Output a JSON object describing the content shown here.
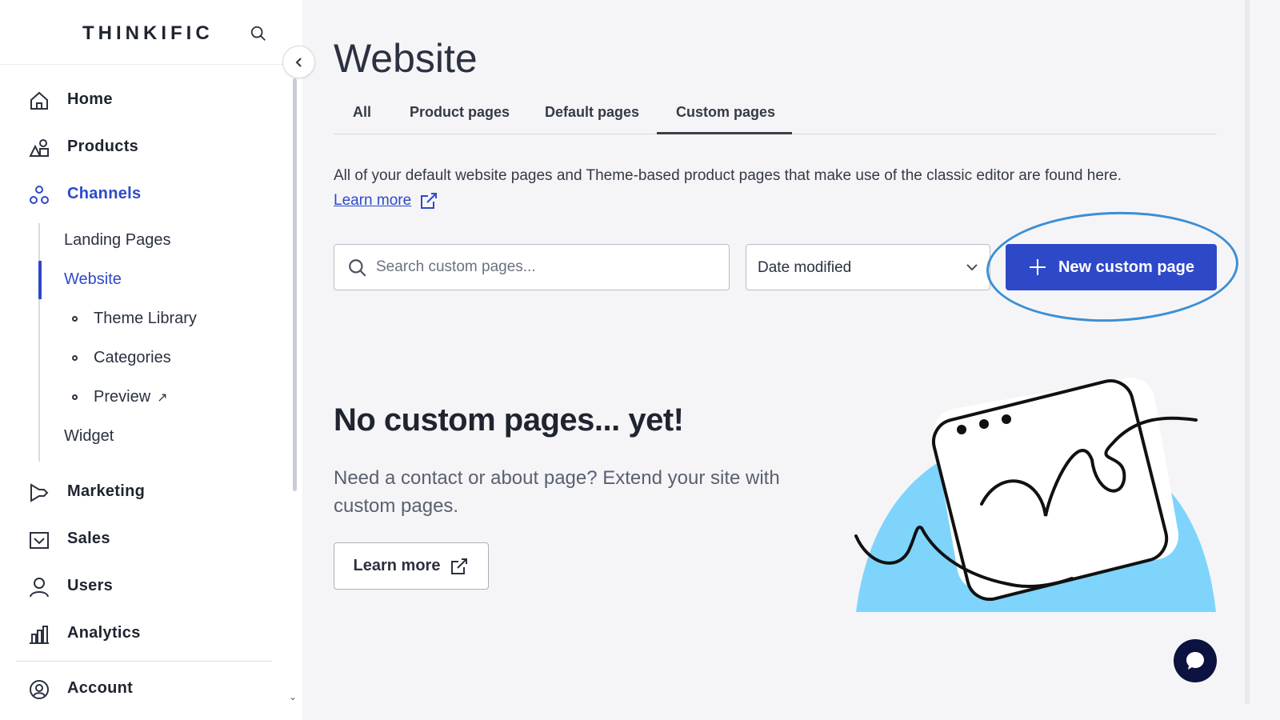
{
  "app": {
    "logo": "THINKIFIC"
  },
  "sidebar": {
    "items": [
      {
        "label": "Home",
        "icon": "home-icon"
      },
      {
        "label": "Products",
        "icon": "shapes-icon"
      },
      {
        "label": "Channels",
        "icon": "channels-icon"
      },
      {
        "label": "Marketing",
        "icon": "megaphone-icon"
      },
      {
        "label": "Sales",
        "icon": "inbox-icon"
      },
      {
        "label": "Users",
        "icon": "user-icon"
      },
      {
        "label": "Analytics",
        "icon": "bar-chart-icon"
      },
      {
        "label": "Account",
        "icon": "account-icon"
      }
    ],
    "channels_sub": {
      "landing_pages": "Landing Pages",
      "website": "Website",
      "theme_library": "Theme Library",
      "categories": "Categories",
      "preview": "Preview",
      "widget": "Widget"
    }
  },
  "main": {
    "title": "Website",
    "tabs": [
      {
        "label": "All"
      },
      {
        "label": "Product pages"
      },
      {
        "label": "Default pages"
      },
      {
        "label": "Custom pages",
        "active": true
      }
    ],
    "description": "All of your default website pages and Theme-based product pages that make use of the classic editor are found here.",
    "learn_more": "Learn more",
    "search": {
      "placeholder": "Search custom pages..."
    },
    "sort": {
      "selected": "Date modified"
    },
    "new_button": "New custom page",
    "empty": {
      "title": "No custom pages... yet!",
      "description": "Need a contact or about page? Extend your site with custom pages.",
      "button": "Learn more"
    }
  },
  "colors": {
    "accent": "#2e49c8",
    "highlight_ring": "#3b8fd6",
    "illustration_blue": "#7fd4fb",
    "chat": "#0c1340"
  }
}
